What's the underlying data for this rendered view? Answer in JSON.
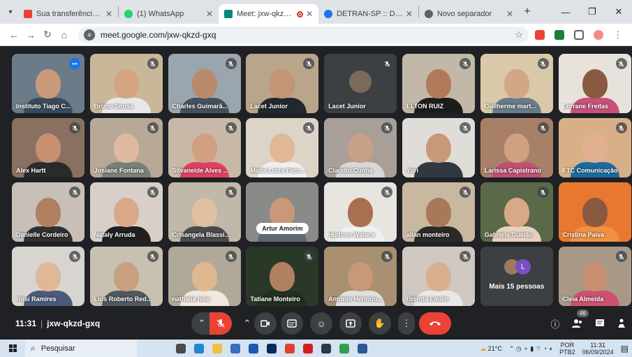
{
  "browser": {
    "tabs": [
      {
        "title": "Sua transferência foi enviada",
        "favicon_color": "#ea4335",
        "active": false
      },
      {
        "title": "(1) WhatsApp",
        "favicon_color": "#25d366",
        "active": false
      },
      {
        "title": "Meet: jxw-qkzd-gxq",
        "favicon_color": "#00897b",
        "active": true
      },
      {
        "title": "DETRAN-SP :: DEPARTAMENTO",
        "favicon_color": "#1a73e8",
        "active": false
      },
      {
        "title": "Novo separador",
        "favicon_color": "#5f6368",
        "active": false
      }
    ],
    "url": "meet.google.com/jxw-qkzd-gxq"
  },
  "meeting": {
    "time": "11:31",
    "code": "jxw-qkzd-gxq",
    "participant_count": "46",
    "pinned_chip": "Artur Amorim",
    "more_label": "Mais 15 pessoas",
    "more_initial": "L",
    "participants": [
      {
        "name": "Instituto Tiago C...",
        "status": "speaking",
        "bg": "#6b7b88",
        "skin": "#c99a7a",
        "shirt": "#3a4a5c",
        "video": true
      },
      {
        "name": "Bruno Sousa",
        "status": "muted",
        "bg": "#c9b79a",
        "skin": "#d4a580",
        "shirt": "#e8e8e8",
        "video": true
      },
      {
        "name": "Charles Guimarã...",
        "status": "muted",
        "bg": "#9ba5ad",
        "skin": "#b88a6a",
        "shirt": "#44505c",
        "video": true
      },
      {
        "name": "Lacet Junior",
        "status": "muted",
        "bg": "#b8a58a",
        "skin": "#c49474",
        "shirt": "#22282e",
        "video": true
      },
      {
        "name": "Lacet Junior",
        "status": "muted",
        "bg": "#3c4043",
        "avatar_color": "#7a6a5a",
        "video": false
      },
      {
        "name": "ELTON RUIZ",
        "status": "muted",
        "bg": "#c2b8a8",
        "skin": "#b07a5a",
        "shirt": "#1c1c1c",
        "video": true
      },
      {
        "name": "Guilherme mart...",
        "status": "muted",
        "bg": "#d9c9a8",
        "skin": "#d1a788",
        "shirt": "#6a7a8a",
        "video": true
      },
      {
        "name": "Lorrane Freitas",
        "status": "muted",
        "bg": "#e8e2dc",
        "skin": "#8a5a40",
        "shirt": "#c8507a",
        "video": true
      },
      {
        "name": "Alex Hartt",
        "status": "muted",
        "bg": "#8a7060",
        "skin": "#c89070",
        "shirt": "#2a2a2a",
        "video": true
      },
      {
        "name": "Josiane Fontana",
        "status": "muted",
        "bg": "#b8a898",
        "skin": "#e0b8a0",
        "shirt": "#7a8078",
        "video": true
      },
      {
        "name": "Silvaneide Alves ...",
        "status": "muted",
        "bg": "#c8b8a8",
        "skin": "#d0a080",
        "shirt": "#e04060",
        "video": true
      },
      {
        "name": "Maria Luiza Fass...",
        "status": "muted",
        "bg": "#ddd4c8",
        "skin": "#e0b898",
        "shirt": "#f0f0f0",
        "video": true
      },
      {
        "name": "Claudio Cunha",
        "status": "muted",
        "bg": "#a8a098",
        "skin": "#c8a088",
        "shirt": "#d8d8d8",
        "video": true
      },
      {
        "name": "Yuri",
        "status": "muted",
        "bg": "#e0ddd8",
        "skin": "#c89878",
        "shirt": "#303840",
        "video": true
      },
      {
        "name": "Larissa Capistrano",
        "status": "muted",
        "bg": "#a88068",
        "skin": "#d0a080",
        "shirt": "#c05070",
        "video": true
      },
      {
        "name": "FTC Comunicação",
        "status": "muted",
        "bg": "#d8b088",
        "skin": "#e0b090",
        "shirt": "#1a6aa0",
        "video": true
      },
      {
        "name": "Danielle Cordeiro",
        "status": "muted",
        "bg": "#c8c0b8",
        "skin": "#b08060",
        "shirt": "#303030",
        "video": true
      },
      {
        "name": "Nataly Arruda",
        "status": "muted",
        "bg": "#d8d0c8",
        "skin": "#d8a888",
        "shirt": "#202020",
        "video": true
      },
      {
        "name": "Crisangela Blassi...",
        "status": "muted",
        "bg": "#c0b8a8",
        "skin": "#e0c0a0",
        "shirt": "#4a4a4a",
        "video": true
      },
      {
        "name": "Artur Amorim",
        "status": "pinned",
        "bg": "#8a8a88",
        "skin": "#c89878",
        "shirt": "#606870",
        "video": true
      },
      {
        "name": "Hudson Walace",
        "status": "muted",
        "bg": "#e8e4e0",
        "skin": "#a87050",
        "shirt": "#f0f0f0",
        "video": true
      },
      {
        "name": "allan monteiro",
        "status": "muted",
        "bg": "#c8b8a0",
        "skin": "#a87858",
        "shirt": "#2a2a2a",
        "video": true
      },
      {
        "name": "Gabriela Guelão",
        "status": "muted",
        "bg": "#5a6a48",
        "skin": "#d8a888",
        "shirt": "#e8d0c0",
        "video": true
      },
      {
        "name": "Cristina Paiva",
        "status": "none",
        "bg": "#e87830",
        "skin": "#8a5a40",
        "shirt": "#f09040",
        "video": true
      },
      {
        "name": "Rosi Ramires",
        "status": "muted",
        "bg": "#d8d4d0",
        "skin": "#e0b898",
        "shirt": "#4a5a7a",
        "video": true
      },
      {
        "name": "Luis Roberto Red...",
        "status": "muted",
        "bg": "#c8c0b0",
        "skin": "#c8a080",
        "shirt": "#505860",
        "video": true
      },
      {
        "name": "nathalia julie",
        "status": "muted",
        "bg": "#b0a898",
        "skin": "#e0b890",
        "shirt": "#f0e8e0",
        "video": true
      },
      {
        "name": "Tatiane Monteiro",
        "status": "muted",
        "bg": "#2a3828",
        "skin": "#b08060",
        "shirt": "#203020",
        "video": true
      },
      {
        "name": "Antonio Henriqu...",
        "status": "muted",
        "bg": "#a89070",
        "skin": "#c89878",
        "shirt": "#e0e0e0",
        "video": true
      },
      {
        "name": "Brenda Emilin",
        "status": "muted",
        "bg": "#d0c8c0",
        "skin": "#d8b090",
        "shirt": "#e8e8e8",
        "video": true
      },
      {
        "name": "Mais 15 pessoas",
        "status": "more",
        "bg": "#3c4043",
        "video": false
      },
      {
        "name": "Cleia Almeida",
        "status": "muted",
        "bg": "#a89888",
        "skin": "#c89070",
        "shirt": "#d05070",
        "video": true
      }
    ]
  },
  "taskbar": {
    "search_placeholder": "Pesquisar",
    "weather": "21°C",
    "lang_top": "POR",
    "lang_bottom": "PTB2",
    "clock_time": "11:31",
    "clock_date": "06/09/2024",
    "apps": [
      {
        "icon": "task-view-icon",
        "color": "#4a4a4a"
      },
      {
        "icon": "edge-icon",
        "color": "#1f8ad0"
      },
      {
        "icon": "file-explorer-icon",
        "color": "#f0c040"
      },
      {
        "icon": "store-icon",
        "color": "#3a6ec0"
      },
      {
        "icon": "mail-icon",
        "color": "#1a5ab0"
      },
      {
        "icon": "photoshop-icon",
        "color": "#0a2a5a"
      },
      {
        "icon": "chrome-icon",
        "color": "#e04030"
      },
      {
        "icon": "pdf-icon",
        "color": "#d02020"
      },
      {
        "icon": "app-icon",
        "color": "#2a3a4a"
      },
      {
        "icon": "chrome-profile-icon",
        "color": "#30a050"
      },
      {
        "icon": "word-icon",
        "color": "#2b579a"
      }
    ]
  }
}
